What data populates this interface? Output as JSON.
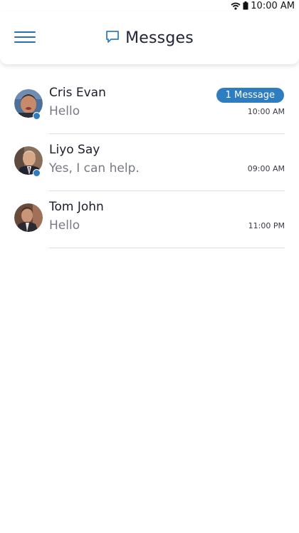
{
  "status_bar": {
    "time": "10:00 AM",
    "icons": [
      "wifi-icon",
      "battery-icon"
    ]
  },
  "header": {
    "title": "Messges",
    "menu_icon": "hamburger-menu-icon",
    "title_icon": "chat-bubble-icon"
  },
  "colors": {
    "accent": "#2f7dc1",
    "menu": "#2a6fae"
  },
  "conversations": [
    {
      "name": "Cris Evan",
      "preview": "Hello",
      "time": "10:00 AM",
      "badge": "1 Message",
      "online": true
    },
    {
      "name": "Liyo Say",
      "preview": "Yes, I can help.",
      "time": "09:00 AM",
      "online": true
    },
    {
      "name": "Tom John",
      "preview": "Hello",
      "time": "11:00 PM",
      "online": false
    }
  ]
}
